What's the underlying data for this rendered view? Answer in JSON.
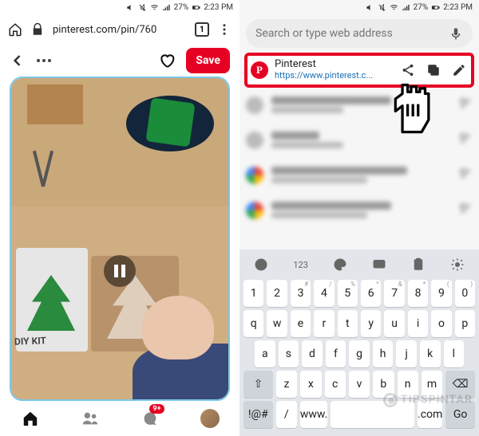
{
  "status": {
    "battery": "27%",
    "time": "2:23 PM"
  },
  "left": {
    "url": "pinterest.com/pin/760",
    "tab_count": "1",
    "save_label": "Save",
    "notif_badge": "9+",
    "kit_label": "DIY KIT"
  },
  "right": {
    "search_placeholder": "Search or type web address",
    "suggestion": {
      "title": "Pinterest",
      "url": "https://www.pinterest.c..."
    },
    "keyboard": {
      "tool_num": "123",
      "row1": [
        {
          "m": "1",
          "s": ""
        },
        {
          "m": "2",
          "s": ""
        },
        {
          "m": "3",
          "s": "#"
        },
        {
          "m": "4",
          "s": "/"
        },
        {
          "m": "5",
          "s": "%"
        },
        {
          "m": "6",
          "s": "^"
        },
        {
          "m": "7",
          "s": "&"
        },
        {
          "m": "8",
          "s": "*"
        },
        {
          "m": "9",
          "s": "("
        },
        {
          "m": "0",
          "s": ")"
        }
      ],
      "row2": [
        "q",
        "w",
        "e",
        "r",
        "t",
        "y",
        "u",
        "i",
        "o",
        "p"
      ],
      "row3": [
        "a",
        "s",
        "d",
        "f",
        "g",
        "h",
        "j",
        "k",
        "l"
      ],
      "row4": [
        "z",
        "x",
        "c",
        "v",
        "b",
        "n",
        "m"
      ],
      "sym": "!@#",
      "slash": "/",
      "www": "www.",
      "com": ".com",
      "go": "Go"
    }
  },
  "watermark": "TIPSPINTAR"
}
